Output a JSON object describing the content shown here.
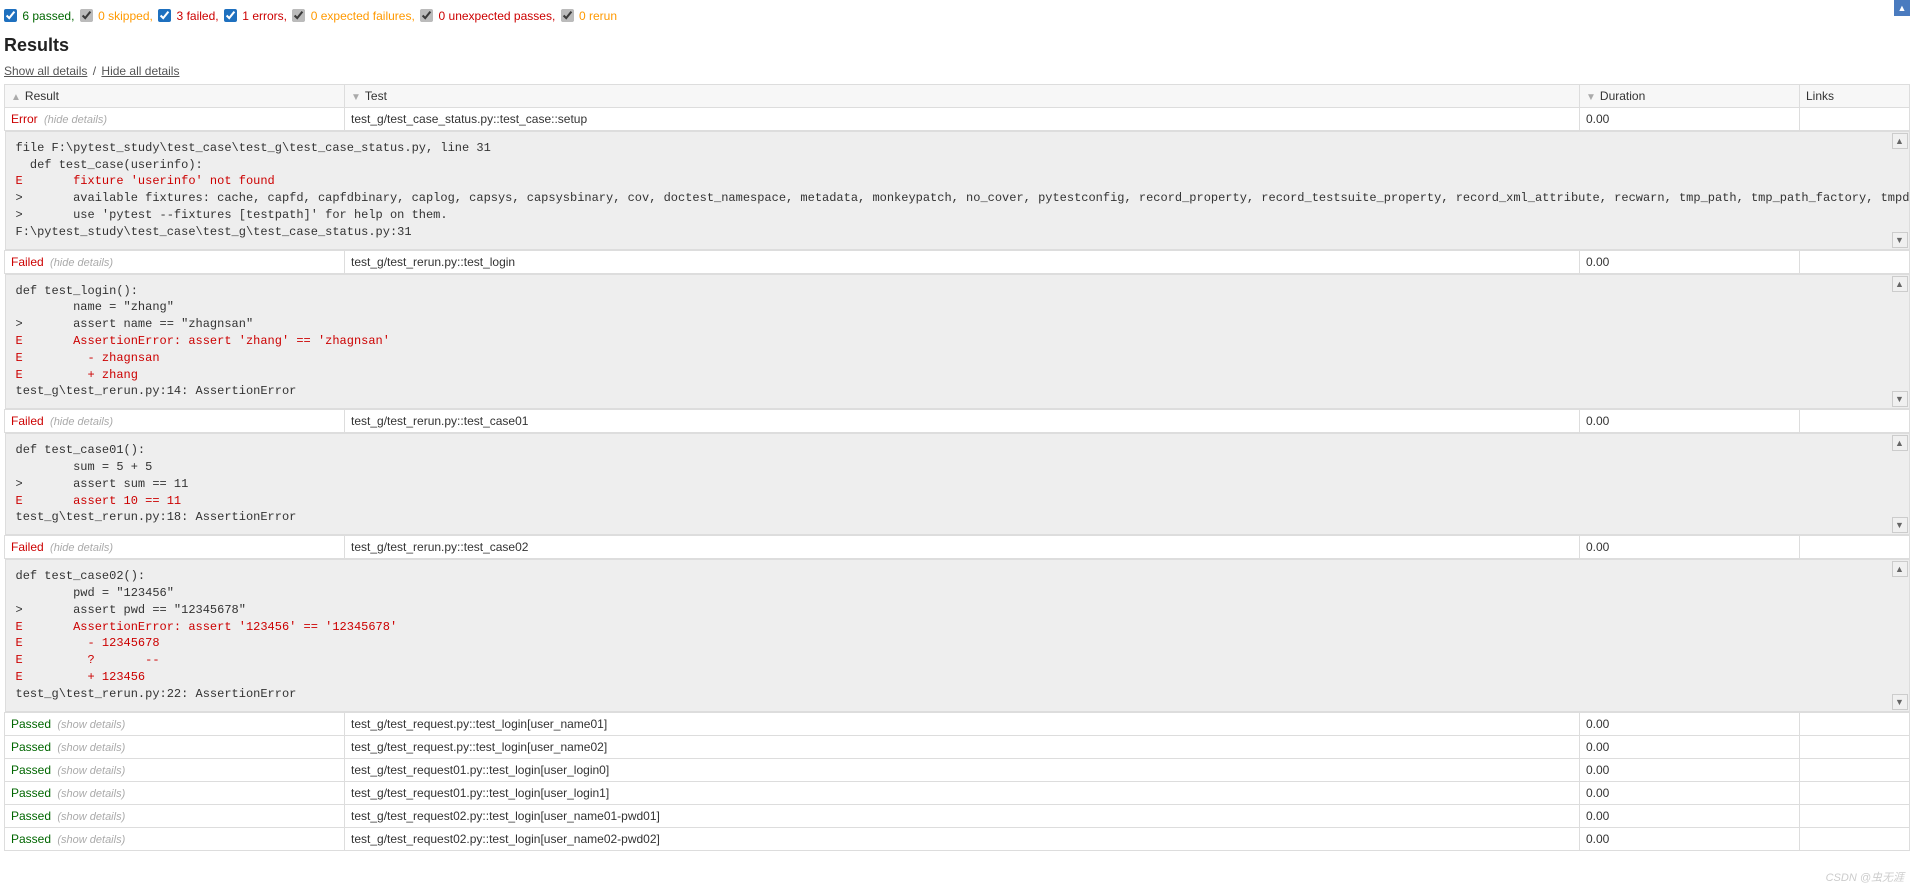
{
  "filters": {
    "passed": {
      "count": 6,
      "label": "passed",
      "checked": true,
      "color": "blue"
    },
    "skipped": {
      "count": 0,
      "label": "skipped",
      "checked": true,
      "color": "gray"
    },
    "failed": {
      "count": 3,
      "label": "failed",
      "checked": true,
      "color": "blue"
    },
    "errors": {
      "count": 1,
      "label": "errors",
      "checked": true,
      "color": "blue"
    },
    "expected": {
      "count": 0,
      "label": "expected failures",
      "checked": true,
      "color": "gray"
    },
    "unexpected": {
      "count": 0,
      "label": "unexpected passes",
      "checked": true,
      "color": "gray"
    },
    "rerun": {
      "count": 0,
      "label": "rerun",
      "checked": true,
      "color": "gray"
    }
  },
  "results_title": "Results",
  "show_all": "Show all details",
  "hide_all": "Hide all details",
  "headers": {
    "result": "Result",
    "test": "Test",
    "duration": "Duration",
    "links": "Links"
  },
  "hide_details_label": "(hide details)",
  "show_details_label": "(show details)",
  "rows": [
    {
      "status": "Error",
      "status_class": "result-cell-error",
      "test": "test_g/test_case_status.py::test_case::setup",
      "duration": "0.00",
      "toggle": "hide",
      "log": [
        {
          "t": "file F:\\pytest_study\\test_case\\test_g\\test_case_status.py, line 31",
          "e": false
        },
        {
          "t": "  def test_case(userinfo):",
          "e": false
        },
        {
          "t": "E       fixture 'userinfo' not found",
          "e": true
        },
        {
          "t": ">       available fixtures: cache, capfd, capfdbinary, caplog, capsys, capsysbinary, cov, doctest_namespace, metadata, monkeypatch, no_cover, pytestconfig, record_property, record_testsuite_property, record_xml_attribute, recwarn, tmp_path, tmp_path_factory, tmpdir, tmpdir_factory, worker_id",
          "e": false
        },
        {
          "t": ">       use 'pytest --fixtures [testpath]' for help on them.",
          "e": false
        },
        {
          "t": "",
          "e": false
        },
        {
          "t": "F:\\pytest_study\\test_case\\test_g\\test_case_status.py:31",
          "e": false
        }
      ]
    },
    {
      "status": "Failed",
      "status_class": "result-cell-failed",
      "test": "test_g/test_rerun.py::test_login",
      "duration": "0.00",
      "toggle": "hide",
      "log": [
        {
          "t": "def test_login():",
          "e": false
        },
        {
          "t": "        name = \"zhang\"",
          "e": false
        },
        {
          "t": ">       assert name == \"zhagnsan\"",
          "e": false
        },
        {
          "t": "E       AssertionError: assert 'zhang' == 'zhagnsan'",
          "e": true
        },
        {
          "t": "E         - zhagnsan",
          "e": true
        },
        {
          "t": "E         + zhang",
          "e": true
        },
        {
          "t": "",
          "e": false
        },
        {
          "t": "test_g\\test_rerun.py:14: AssertionError",
          "e": false
        }
      ]
    },
    {
      "status": "Failed",
      "status_class": "result-cell-failed",
      "test": "test_g/test_rerun.py::test_case01",
      "duration": "0.00",
      "toggle": "hide",
      "log": [
        {
          "t": "def test_case01():",
          "e": false
        },
        {
          "t": "        sum = 5 + 5",
          "e": false
        },
        {
          "t": ">       assert sum == 11",
          "e": false
        },
        {
          "t": "E       assert 10 == 11",
          "e": true
        },
        {
          "t": "",
          "e": false
        },
        {
          "t": "test_g\\test_rerun.py:18: AssertionError",
          "e": false
        }
      ]
    },
    {
      "status": "Failed",
      "status_class": "result-cell-failed",
      "test": "test_g/test_rerun.py::test_case02",
      "duration": "0.00",
      "toggle": "hide",
      "log": [
        {
          "t": "def test_case02():",
          "e": false
        },
        {
          "t": "        pwd = \"123456\"",
          "e": false
        },
        {
          "t": ">       assert pwd == \"12345678\"",
          "e": false
        },
        {
          "t": "E       AssertionError: assert '123456' == '12345678'",
          "e": true
        },
        {
          "t": "E         - 12345678",
          "e": true
        },
        {
          "t": "E         ?       --",
          "e": true
        },
        {
          "t": "E         + 123456",
          "e": true
        },
        {
          "t": "",
          "e": false
        },
        {
          "t": "test_g\\test_rerun.py:22: AssertionError",
          "e": false
        }
      ]
    },
    {
      "status": "Passed",
      "status_class": "result-cell-passed",
      "test": "test_g/test_request.py::test_login[user_name01]",
      "duration": "0.00",
      "toggle": "show"
    },
    {
      "status": "Passed",
      "status_class": "result-cell-passed",
      "test": "test_g/test_request.py::test_login[user_name02]",
      "duration": "0.00",
      "toggle": "show"
    },
    {
      "status": "Passed",
      "status_class": "result-cell-passed",
      "test": "test_g/test_request01.py::test_login[user_login0]",
      "duration": "0.00",
      "toggle": "show"
    },
    {
      "status": "Passed",
      "status_class": "result-cell-passed",
      "test": "test_g/test_request01.py::test_login[user_login1]",
      "duration": "0.00",
      "toggle": "show"
    },
    {
      "status": "Passed",
      "status_class": "result-cell-passed",
      "test": "test_g/test_request02.py::test_login[user_name01-pwd01]",
      "duration": "0.00",
      "toggle": "show"
    },
    {
      "status": "Passed",
      "status_class": "result-cell-passed",
      "test": "test_g/test_request02.py::test_login[user_name02-pwd02]",
      "duration": "0.00",
      "toggle": "show"
    }
  ],
  "watermark": "CSDN @虫无涯"
}
